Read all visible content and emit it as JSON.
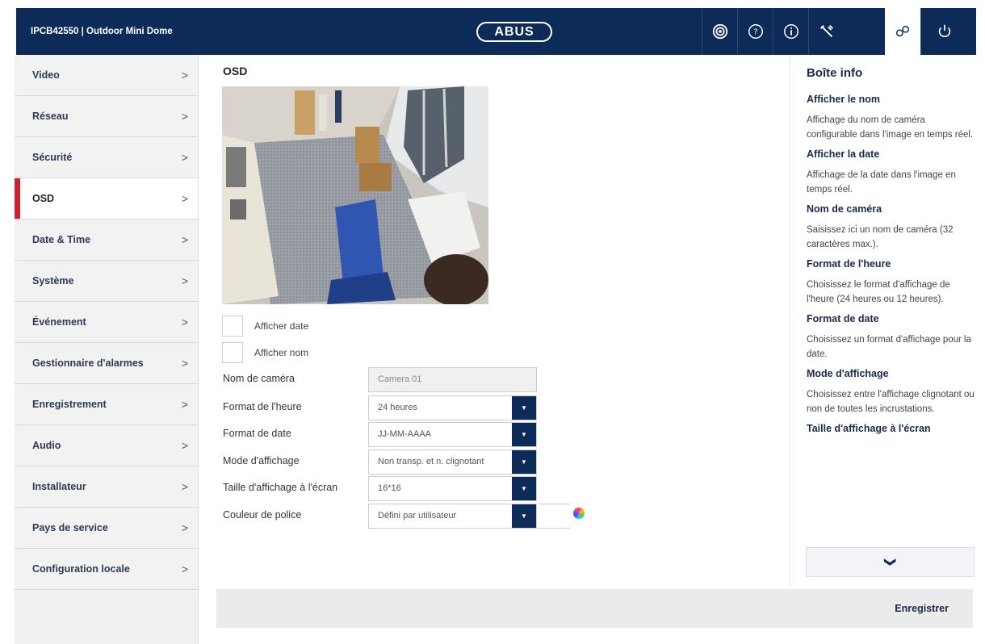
{
  "header": {
    "title": "IPCB42550 | Outdoor Mini Dome",
    "logo": "ABUS",
    "icons": [
      "camera-icon",
      "help-icon",
      "info-icon",
      "tools-icon",
      "settings-icon",
      "power-icon"
    ],
    "active_icon": "settings-icon",
    "colors": {
      "header_bg": "#0d2b59",
      "accent": "#d0202d"
    }
  },
  "sidebar": {
    "items": [
      {
        "label": "Video",
        "chevron": ">"
      },
      {
        "label": "Réseau",
        "chevron": ">"
      },
      {
        "label": "Sécurité",
        "chevron": ">"
      },
      {
        "label": "OSD",
        "chevron": ">"
      },
      {
        "label": "Date & Time",
        "chevron": ">"
      },
      {
        "label": "Système",
        "chevron": ">"
      },
      {
        "label": "Événement",
        "chevron": ">"
      },
      {
        "label": "Gestionnaire d'alarmes",
        "chevron": ">"
      },
      {
        "label": "Enregistrement",
        "chevron": ">"
      },
      {
        "label": "Audio",
        "chevron": ">"
      },
      {
        "label": "Installateur",
        "chevron": ">"
      },
      {
        "label": "Pays de service",
        "chevron": ">"
      },
      {
        "label": "Configuration locale",
        "chevron": ">"
      }
    ],
    "active_index": 3
  },
  "main": {
    "title": "OSD",
    "checkboxes": [
      {
        "label": "Afficher date",
        "checked": false
      },
      {
        "label": "Afficher nom",
        "checked": false
      }
    ],
    "form": {
      "camera_name": {
        "label": "Nom de caméra",
        "value": "Camera 01"
      },
      "time_format": {
        "label": "Format de l'heure",
        "value": "24 heures"
      },
      "date_format": {
        "label": "Format de date",
        "value": "JJ-MM-AAAA"
      },
      "display_mode": {
        "label": "Mode d'affichage",
        "value": "Non transp. et n. clignotant"
      },
      "osd_size": {
        "label": "Taille d'affichage à l'écran",
        "value": "16*16"
      },
      "font_color": {
        "label": "Couleur de police",
        "value": "Défini par utilisateur"
      }
    },
    "save_label": "Enregistrer"
  },
  "info": {
    "title": "Boîte info",
    "sections": [
      {
        "heading": "Afficher le nom",
        "text": "Affichage du nom de caméra configurable dans l'image en temps réel."
      },
      {
        "heading": "Afficher la date",
        "text": "Affichage de la date dans l'image en temps réel."
      },
      {
        "heading": "Nom de caméra",
        "text": "Saisissez ici un nom de caméra (32 caractères max.)."
      },
      {
        "heading": "Format de l'heure",
        "text": "Choisissez le format d'affichage de l'heure (24 heures ou 12 heures)."
      },
      {
        "heading": "Format de date",
        "text": "Choisissez un format d'affichage pour la date."
      },
      {
        "heading": "Mode d'affichage",
        "text": "Choisissez entre l'affichage clignotant ou non de toutes les incrustations."
      },
      {
        "heading": "Taille d'affichage à l'écran",
        "text": ""
      }
    ],
    "more_icon": "chevron-down-icon"
  }
}
